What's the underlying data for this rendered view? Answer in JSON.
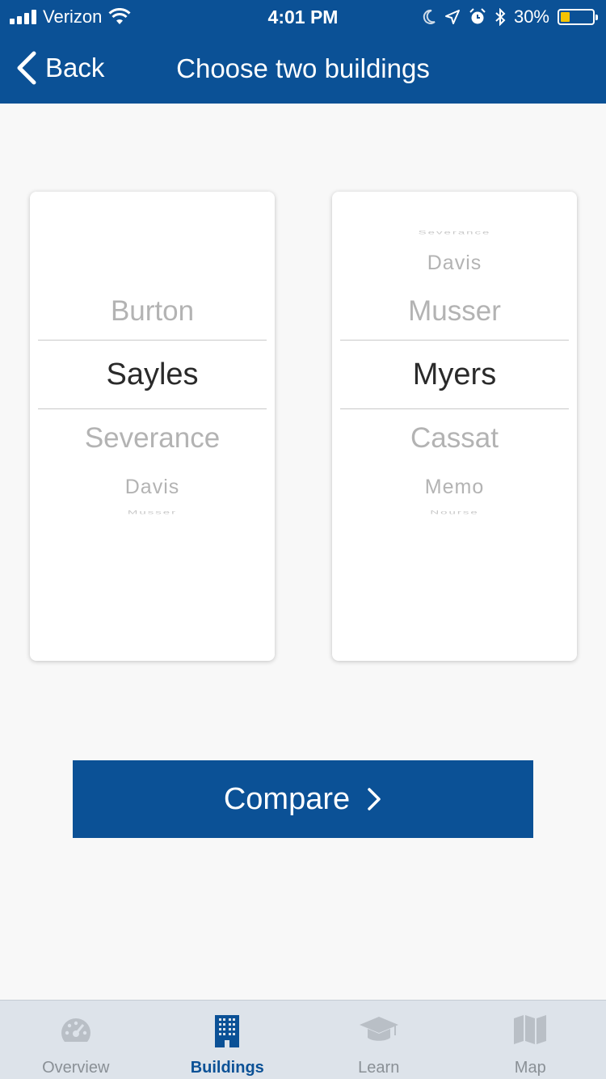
{
  "status_bar": {
    "carrier": "Verizon",
    "time": "4:01 PM",
    "battery_percent": "30%",
    "battery_level": 0.3,
    "icons": [
      "signal-icon",
      "wifi-icon",
      "moon-icon",
      "location-icon",
      "alarm-icon",
      "bluetooth-icon",
      "battery-icon"
    ]
  },
  "nav": {
    "back_label": "Back",
    "title": "Choose two buildings"
  },
  "picker_left": {
    "above3": "",
    "above2": "",
    "above1": "Burton",
    "selected": "Sayles",
    "below1": "Severance",
    "below2": "Davis",
    "below3": "Musser"
  },
  "picker_right": {
    "above3": "Severance",
    "above2": "Davis",
    "above1": "Musser",
    "selected": "Myers",
    "below1": "Cassat",
    "below2": "Memo",
    "below3": "Nourse"
  },
  "compare_label": "Compare",
  "tabs": [
    {
      "label": "Overview",
      "icon": "gauge-icon",
      "active": false
    },
    {
      "label": "Buildings",
      "icon": "building-icon",
      "active": true
    },
    {
      "label": "Learn",
      "icon": "graduation-cap-icon",
      "active": false
    },
    {
      "label": "Map",
      "icon": "map-icon",
      "active": false
    }
  ],
  "colors": {
    "brand": "#0b5196",
    "background": "#f8f8f8",
    "tabbar": "#dde3ea",
    "inactive_tab": "#8a9096"
  }
}
